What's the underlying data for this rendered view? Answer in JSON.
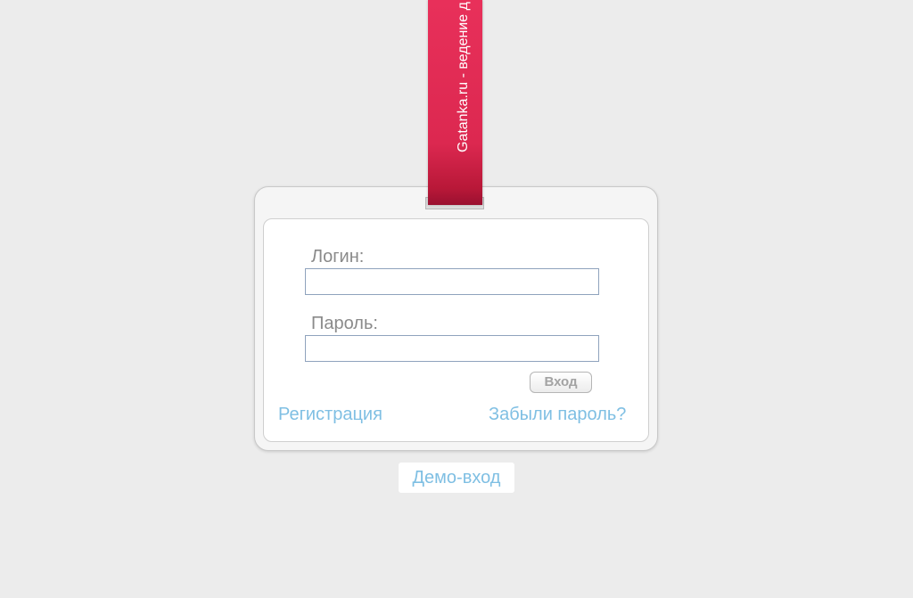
{
  "ribbon": {
    "text": "Gatanka.ru - ведение д"
  },
  "login_form": {
    "login_label": "Логин:",
    "login_value": "",
    "password_label": "Пароль:",
    "password_value": "",
    "submit_label": "Вход",
    "register_link": "Регистрация",
    "forgot_link": "Забыли пароль?"
  },
  "demo": {
    "link_label": "Демо-вход"
  },
  "colors": {
    "background": "#ececec",
    "ribbon": "#dc2850",
    "link": "#7fbfe3",
    "label": "#8a8a8a",
    "input_border": "#8fa3bd"
  }
}
